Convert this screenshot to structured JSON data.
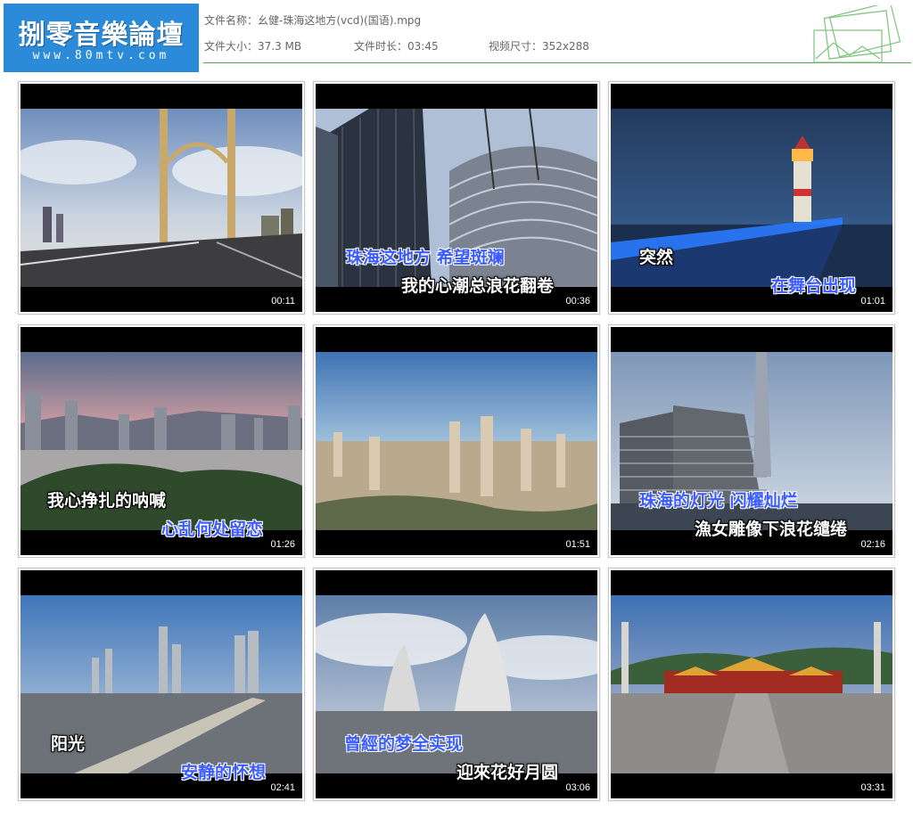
{
  "header": {
    "logo_title": "捌零音樂論壇",
    "logo_url": "www.80mtv.com",
    "file_name_label": "文件名称：",
    "file_name": "幺健-珠海这地方(vcd)(国语).mpg",
    "file_size_label": "文件大小：",
    "file_size": "37.3 MB",
    "duration_label": "文件时长：",
    "duration": "03:45",
    "video_size_label": "视频尺寸：",
    "video_size": "352x288"
  },
  "thumbnails": [
    {
      "time": "00:11",
      "scene": "bridge",
      "subtitle_top": "",
      "subtitle_bottom": ""
    },
    {
      "time": "00:36",
      "scene": "towers",
      "subtitle_top": "珠海这地方 希望斑斓",
      "subtitle_bottom": "我的心潮总浪花翻卷"
    },
    {
      "time": "01:01",
      "scene": "lighthouse",
      "subtitle_top": "突然",
      "subtitle_bottom": "在舞台出现"
    },
    {
      "time": "01:26",
      "scene": "city-dusk",
      "subtitle_top": "我心挣扎的呐喊",
      "subtitle_bottom": "心乱何处留恋"
    },
    {
      "time": "01:51",
      "scene": "city-aerial",
      "subtitle_top": "",
      "subtitle_bottom": ""
    },
    {
      "time": "02:16",
      "scene": "hotel",
      "subtitle_top": "珠海的灯光 闪耀灿烂",
      "subtitle_bottom": "漁女雕像下浪花缱绻"
    },
    {
      "time": "02:41",
      "scene": "waterfront",
      "subtitle_top": "阳光",
      "subtitle_bottom": "安静的怀想"
    },
    {
      "time": "03:06",
      "scene": "opera",
      "subtitle_top": "曾經的梦全实现",
      "subtitle_bottom": "迎來花好月圆"
    },
    {
      "time": "03:31",
      "scene": "temple",
      "subtitle_top": "",
      "subtitle_bottom": ""
    }
  ]
}
